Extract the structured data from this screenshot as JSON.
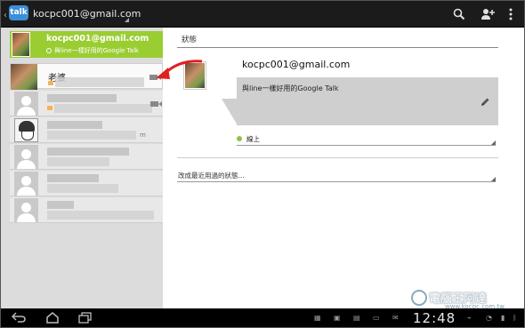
{
  "actionbar": {
    "app_icon_label": "talk",
    "title": "kocpc001@gmail.com",
    "icons": [
      "search-icon",
      "add-person-icon",
      "overflow-menu-icon"
    ]
  },
  "self": {
    "email": "kocpc001@gmail.com",
    "status": "與line一樣好用的Google Talk"
  },
  "contacts": [
    {
      "name": "老婆",
      "avatar": "photo",
      "video": true
    },
    {
      "name": "",
      "avatar": "person",
      "video": true
    },
    {
      "name": "",
      "avatar": "cartoon",
      "video": false,
      "suffix": "m"
    },
    {
      "name": "",
      "avatar": "person",
      "video": false
    },
    {
      "name": "",
      "avatar": "person",
      "video": false
    },
    {
      "name": "",
      "avatar": "person",
      "video": false
    }
  ],
  "detail": {
    "section_title": "狀態",
    "email": "kocpc001@gmail.com",
    "status_message": "與line一樣好用的Google Talk",
    "presence_label": "線上",
    "presence_color": "#8bc34a",
    "recent_status_label": "改成最近用過的狀態..."
  },
  "sysbar": {
    "clock": "12:48",
    "nav_icons": [
      "back-icon",
      "home-icon",
      "recent-apps-icon"
    ]
  },
  "watermark": {
    "text": "電腦王阿達",
    "url": "www.kocpc.com.tw"
  },
  "colors": {
    "accent_green": "#9acd32",
    "actionbar_bg": "#1b1b1b",
    "annotation_arrow": "#e02020"
  }
}
